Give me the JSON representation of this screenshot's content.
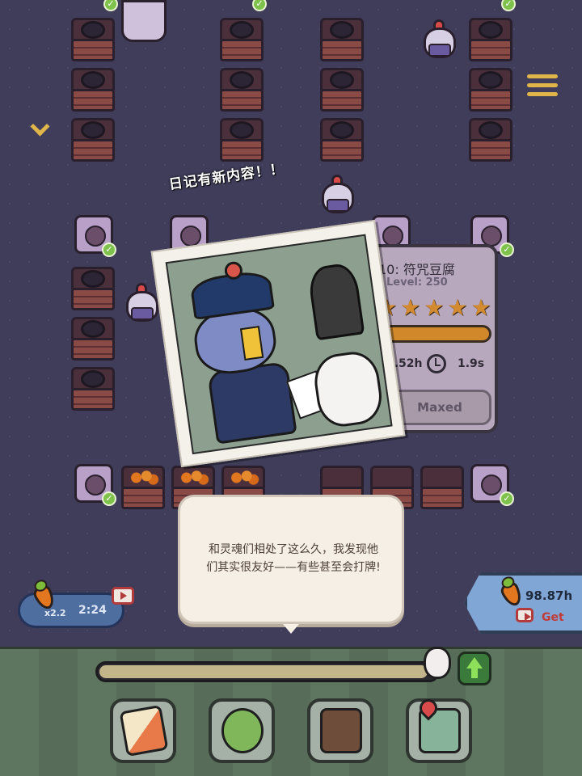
{
  "diary_notice": "日记有新内容！！",
  "info_panel": {
    "recipe_name": "10: 符咒豆腐",
    "level_label": "Level: 250",
    "star_count": 5,
    "profit": "7.52h",
    "cook_time": "1.9s",
    "button_label": "Maxed"
  },
  "dialog": {
    "text": "和灵魂们相处了这么久，我发现他们其实很友好——有些甚至会打牌!"
  },
  "boost": {
    "multiplier": "x2.2",
    "timer": "2:24"
  },
  "offline_earnings": {
    "amount": "98.87h",
    "get_label": "Get"
  },
  "progress": {
    "fraction": 0.98
  },
  "colors": {
    "background": "#3d3a55",
    "accent_yellow": "#e0b54a",
    "star_orange": "#d48a2f",
    "check_green": "#7ec14b"
  },
  "icons": [
    "menu-icon",
    "chevron-down-icon",
    "check-icon",
    "star-icon",
    "clock-icon",
    "carrot-icon",
    "tv-icon",
    "up-arrow-icon",
    "cards-icon",
    "tree-icon",
    "book-icon",
    "map-icon"
  ]
}
